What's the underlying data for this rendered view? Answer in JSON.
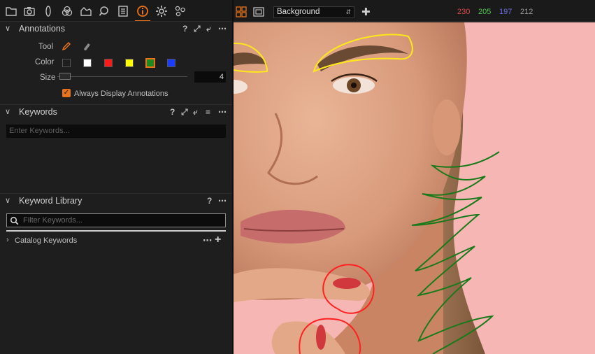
{
  "toolbar": {
    "tabs": [
      {
        "name": "library-tab-icon"
      },
      {
        "name": "capture-tab-icon"
      },
      {
        "name": "lens-tab-icon"
      },
      {
        "name": "color-tab-icon"
      },
      {
        "name": "exposure-tab-icon"
      },
      {
        "name": "details-tab-icon"
      },
      {
        "name": "metadata-tab-icon"
      },
      {
        "name": "adjustments-tab-icon",
        "active": true
      },
      {
        "name": "output-tab-icon"
      },
      {
        "name": "batch-tab-icon"
      }
    ]
  },
  "annotations": {
    "title": "Annotations",
    "tool_label": "Tool",
    "color_label": "Color",
    "size_label": "Size",
    "size_value": "4",
    "size_fraction": 0.02,
    "always_display_label": "Always Display Annotations",
    "always_display_checked": true,
    "colors": [
      "#1e1e1e",
      "#ffffff",
      "#ff1a1a",
      "#ffff00",
      "#1e8a1e",
      "#1a3cff"
    ],
    "selected_color": "#1e8a1e"
  },
  "keywords": {
    "title": "Keywords",
    "placeholder": "Enter Keywords..."
  },
  "keyword_library": {
    "title": "Keyword Library",
    "filter_placeholder": "Filter Keywords...",
    "catalog_label": "Catalog Keywords"
  },
  "viewer_toolbar": {
    "background_select": "Background",
    "rgb": {
      "r": "230",
      "g": "205",
      "b": "197",
      "l": "212"
    },
    "colors": {
      "r": "#e04848",
      "g": "#4ec84e",
      "b": "#6d6de8",
      "l": "#9a9a9a",
      "accent": "#e8731a"
    }
  }
}
